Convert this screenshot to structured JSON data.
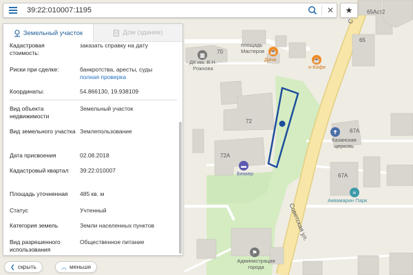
{
  "search": {
    "query": "39:22:010007:1195"
  },
  "tabs": {
    "land": "Земельный участок",
    "house": "Дом (здание)"
  },
  "fields": [
    {
      "label": "Кадастровая стоимость:",
      "value": "заказать справку на дату",
      "link": true
    },
    {
      "label": "Риски при сделке:",
      "value": "банкротства, аресты, суды",
      "value2": "полная проверка"
    },
    {
      "label": "Координаты:",
      "value": "54.866130, 19.938109"
    },
    {
      "label": "Вид объекта недвижимости",
      "value": "Земельный участок"
    },
    {
      "label": "Вид земельного участка",
      "value": "Землепользование"
    },
    {
      "label": "Дата присвоения",
      "value": "02.08.2018"
    },
    {
      "label": "Кадастровый квартал",
      "value": "39:22:010007"
    },
    {
      "label": "Площадь уточненная",
      "value": "485 кв. м"
    },
    {
      "label": "Статус",
      "value": "Учтенный"
    },
    {
      "label": "Категория земель",
      "value": "Земли населенных пунктов"
    },
    {
      "label": "Вид разрешенного использования",
      "value": "Общественное питание"
    }
  ],
  "buttons": {
    "hide": "скрыть",
    "less": "меньше"
  },
  "map": {
    "labels": {
      "b70": "70",
      "b72": "72",
      "b72a": "72А",
      "b65": "65",
      "b65ast2": "65Аст2",
      "b67a_top": "67А",
      "b67a_bot": "67А",
      "square": "площадь Мастеров",
      "street_top": "С",
      "street": "Советская ул.",
      "dk": "ДК им. В.Н. Рожкова",
      "dacha": "Дача",
      "cafe": "и Кофе",
      "church": "Казанская церковь",
      "hotel": "Беккер",
      "aqua": "Аквамарин Парк",
      "admin": "Администрация города"
    },
    "colors": {
      "parcel_outline": "#1c4e9c",
      "parcel_dot": "#1c4e9c",
      "park": "#d5ecc2",
      "road": "#ffffff",
      "main_road": "#f7e6a8",
      "building": "#d9d6cf",
      "building_dark": "#cfcbc2",
      "poi_orange": "#f08a24",
      "poi_blue": "#4a6fa8",
      "poi_gray": "#777777",
      "poi_teal": "#3c9aa8",
      "poi_purple": "#5b59b0",
      "accent": "#2a6fb0"
    }
  }
}
